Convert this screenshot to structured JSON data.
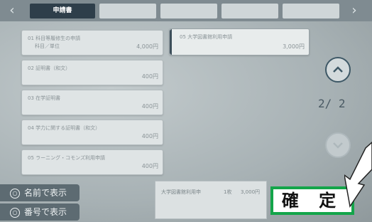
{
  "tabs": [
    {
      "label": "申請書",
      "active": true
    },
    {
      "label": "",
      "active": false
    },
    {
      "label": "",
      "active": false
    },
    {
      "label": "",
      "active": false
    },
    {
      "label": "",
      "active": false
    }
  ],
  "items": [
    {
      "name": "01 科目等履修生の申請",
      "sub": "科目／単位",
      "price": "4,000円"
    },
    {
      "name": "02 証明書（和文）",
      "sub": "",
      "price": "400円"
    },
    {
      "name": "03 在学証明書",
      "sub": "",
      "price": "400円"
    },
    {
      "name": "04 学力に関する証明書（和文）",
      "sub": "",
      "price": "400円"
    },
    {
      "name": "05 ラーニング・コモンズ利用申請",
      "sub": "",
      "price": "400円"
    }
  ],
  "selected_item": {
    "name": "05 大学図書館利用申請",
    "price": "3,000円"
  },
  "page_indicator": "2/ 2",
  "left_buttons": [
    {
      "label": "名前で表示"
    },
    {
      "label": "番号で表示"
    }
  ],
  "summary": {
    "label": "大学図書館利用申",
    "count": "1枚",
    "amount": "3,000円"
  },
  "confirm_label": "確 定",
  "colors": {
    "confirm_border": "#14a54a",
    "active_tab": "#2e3e4a"
  }
}
